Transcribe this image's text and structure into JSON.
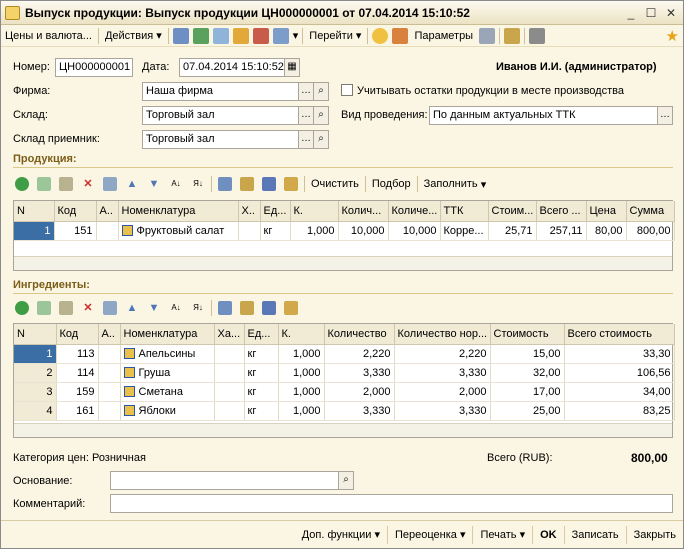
{
  "window": {
    "title": "Выпуск продукции: Выпуск продукции ЦН000000001 от 07.04.2014 15:10:52"
  },
  "toolbar": {
    "prices_label": "Цены и валюта...",
    "actions_label": "Действия",
    "goto_label": "Перейти",
    "params_label": "Параметры"
  },
  "header": {
    "number_label": "Номер:",
    "number_value": "ЦН000000001",
    "date_label": "Дата:",
    "date_value": "07.04.2014 15:10:52",
    "user": "Иванов И.И. (администратор)",
    "firm_label": "Фирма:",
    "firm_value": "Наша фирма",
    "checkbox_label": "Учитывать остатки продукции в месте производства",
    "warehouse_label": "Склад:",
    "warehouse_value": "Торговый зал",
    "posting_label": "Вид проведения:",
    "posting_value": "По данным актуальных ТТК",
    "recv_label": "Склад приемник:",
    "recv_value": "Торговый зал"
  },
  "products": {
    "title": "Продукция:",
    "clear_label": "Очистить",
    "select_label": "Подбор",
    "fill_label": "Заполнить",
    "columns": [
      "N",
      "Код",
      "А..",
      "Номенклатура",
      "Х..",
      "Ед...",
      "К.",
      "Колич...",
      "Количе...",
      "ТТК",
      "Стоим...",
      "Всего ...",
      "Цена",
      "Сумма"
    ],
    "rows": [
      [
        "1",
        "151",
        "",
        "Фруктовый салат",
        "",
        "кг",
        "1,000",
        "10,000",
        "10,000",
        "Корре...",
        "25,71",
        "257,11",
        "80,00",
        "800,00"
      ]
    ]
  },
  "ingredients": {
    "title": "Ингредиенты:",
    "columns": [
      "N",
      "Код",
      "А..",
      "Номенклатура",
      "Ха...",
      "Ед...",
      "К.",
      "Количество",
      "Количество нор...",
      "Стоимость",
      "Всего стоимость"
    ],
    "rows": [
      [
        "1",
        "113",
        "",
        "Апельсины",
        "",
        "кг",
        "1,000",
        "2,220",
        "2,220",
        "15,00",
        "33,30"
      ],
      [
        "2",
        "114",
        "",
        "Груша",
        "",
        "кг",
        "1,000",
        "3,330",
        "3,330",
        "32,00",
        "106,56"
      ],
      [
        "3",
        "159",
        "",
        "Сметана",
        "",
        "кг",
        "1,000",
        "2,000",
        "2,000",
        "17,00",
        "34,00"
      ],
      [
        "4",
        "161",
        "",
        "Яблоки",
        "",
        "кг",
        "1,000",
        "3,330",
        "3,330",
        "25,00",
        "83,25"
      ]
    ]
  },
  "footer": {
    "price_category": "Категория цен: Розничная",
    "total_label": "Всего (RUB):",
    "total_value": "800,00",
    "basis_label": "Основание:",
    "basis_value": "",
    "comment_label": "Комментарий:",
    "comment_value": ""
  },
  "bottom": {
    "extra_label": "Доп. функции",
    "reprice_label": "Переоценка",
    "print_label": "Печать",
    "ok_label": "OK",
    "save_label": "Записать",
    "close_label": "Закрыть"
  }
}
